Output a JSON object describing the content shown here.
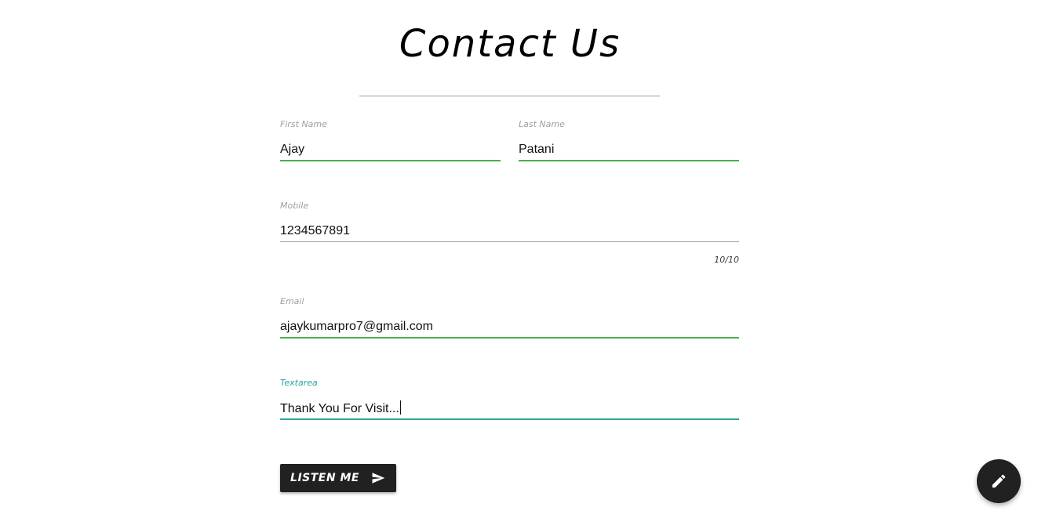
{
  "page": {
    "title": "Contact Us"
  },
  "form": {
    "first_name": {
      "label": "First Name",
      "value": "Ajay"
    },
    "last_name": {
      "label": "Last Name",
      "value": "Patani"
    },
    "mobile": {
      "label": "Mobile",
      "value": "1234567891",
      "counter": "10/10"
    },
    "email": {
      "label": "Email",
      "value": "ajaykumarpro7@gmail.com"
    },
    "textarea": {
      "label": "Textarea",
      "value": "Thank You For Visit..."
    },
    "submit_label": "LISTEN ME",
    "submit_icon": "send-icon"
  },
  "fab": {
    "icon": "pencil-icon"
  },
  "colors": {
    "valid_underline": "#4caf50",
    "active_underline": "#26a69a",
    "button": "#212121"
  }
}
